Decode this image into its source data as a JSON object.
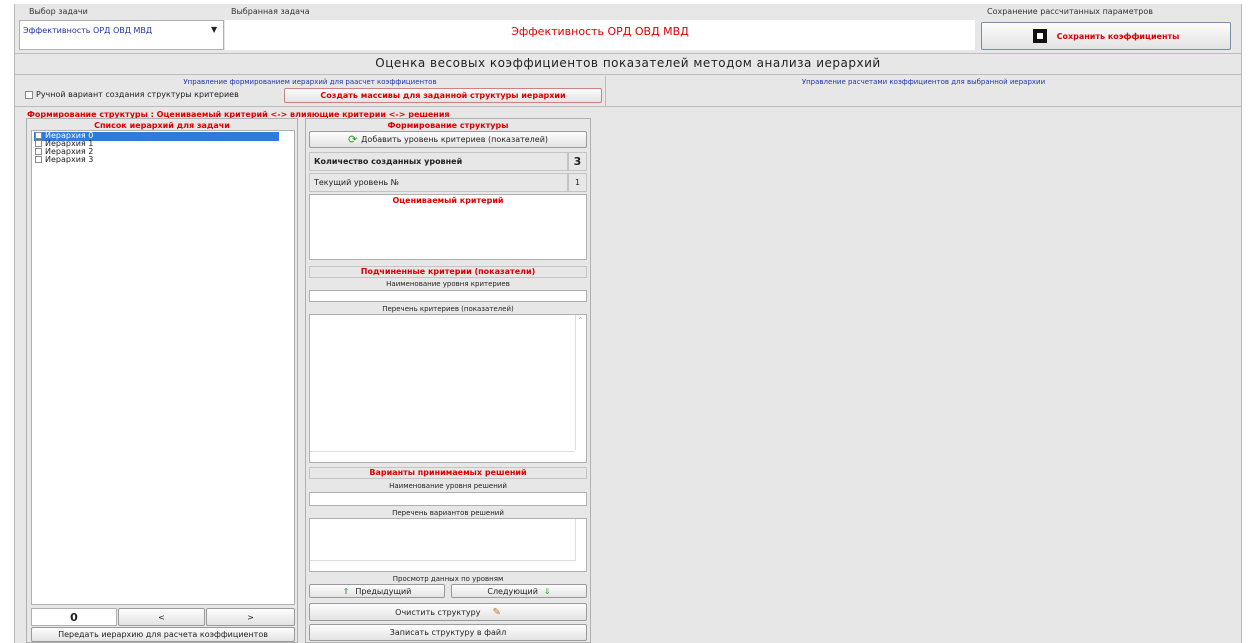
{
  "top": {
    "task_select_label": "Выбор задачи",
    "task_select_value": "Эффективность ОРД ОВД МВД",
    "selected_task_label": "Выбранная задача",
    "selected_task_value": "Эффективность ОРД ОВД МВД",
    "save_group_label": "Сохранение рассчитанных параметров",
    "save_button": "Сохранить коэффициенты"
  },
  "main_title": "Оценка весовых коэффициентов показателей методом анализа иерархий",
  "hierarchy_mgmt": {
    "title": "Управление формированием иерархий для раасчет коэффициентов",
    "manual_checkbox": "Ручной вариант создания структуры критериев",
    "create_button": "Создать массивы для заданной структуры иерархии"
  },
  "calc_mgmt_title": "Управление расчетами коэффициентов для выбранной иерархии",
  "structure_header": "Формирование структуры : Оцениваемый критерий <-> влияющие критерии <-> решения",
  "list": {
    "title": "Список иерархий для задачи",
    "items": [
      "Иерархия 0",
      "Иерархия 1",
      "Иерархия 2",
      "Иерархия 3"
    ],
    "counter": "0",
    "prev": "<",
    "next": ">",
    "transfer_button": "Передать иерархию для расчета коэффициентов"
  },
  "structure": {
    "title": "Формирование структуры",
    "add_level_button": "Добавить уровень критериев (показателей)",
    "levels_count_label": "Количество созданных уровней",
    "levels_count_value": "3",
    "current_level_label": "Текущий уровень №",
    "current_level_value": "1",
    "evaluated_criterion": "Оцениваемый критерий",
    "sub_criteria": "Подчиненные критерии (показатели)",
    "criteria_level_name": "Наименование уровня критериев",
    "criteria_list": "Перечень критериев (показателей)",
    "decisions_title": "Варианты принимаемых решений",
    "decisions_level_name": "Наименование уровня решений",
    "decisions_list": "Перечень вариантов решений",
    "view_by_levels": "Просмотр данных по уровням",
    "prev_button": "Предыдущий",
    "next_button": "Следующий",
    "clear_button": "Очистить структуру",
    "save_file_button": "Записать структуру в файл"
  },
  "colors": {
    "accent_red": "#e00000",
    "selection_blue": "#2e7bdc",
    "label_blue": "#2233aa"
  }
}
